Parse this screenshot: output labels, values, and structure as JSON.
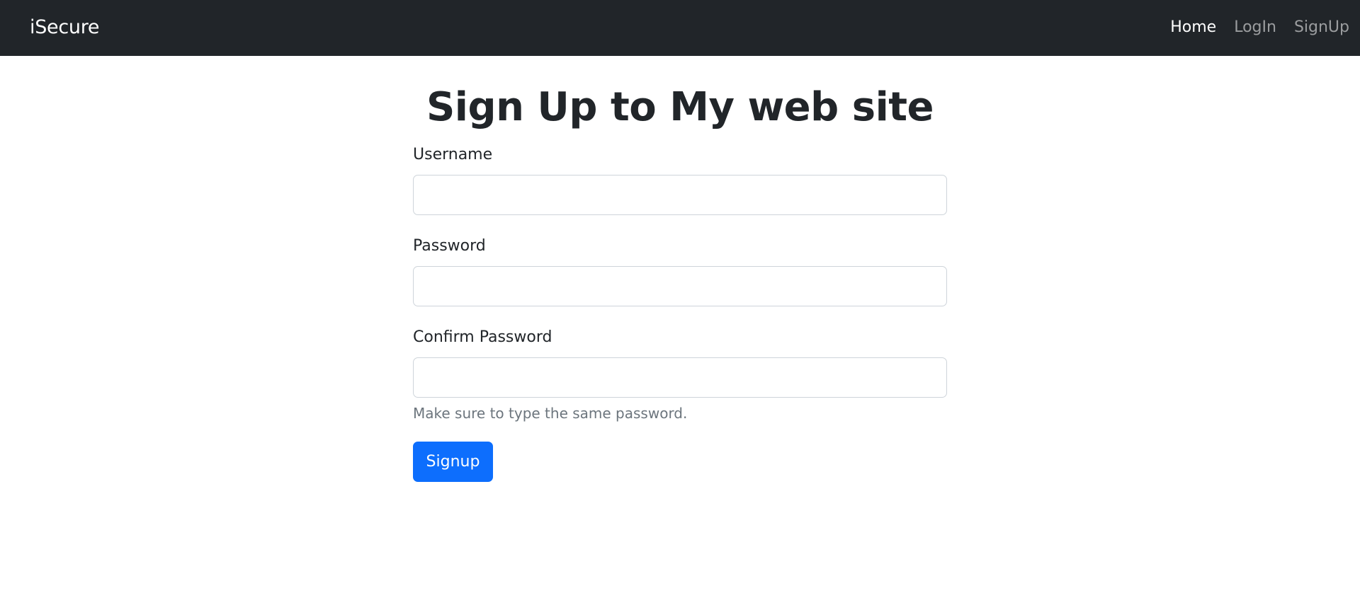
{
  "navbar": {
    "brand": "iSecure",
    "links": [
      {
        "label": "Home",
        "active": true
      },
      {
        "label": "LogIn",
        "active": false
      },
      {
        "label": "SignUp",
        "active": false
      }
    ]
  },
  "page": {
    "title": "Sign Up to My web site"
  },
  "form": {
    "username": {
      "label": "Username",
      "value": "",
      "placeholder": ""
    },
    "password": {
      "label": "Password",
      "value": "",
      "placeholder": ""
    },
    "confirm_password": {
      "label": "Confirm Password",
      "value": "",
      "placeholder": ""
    },
    "help_text": "Make sure to type the same password.",
    "submit_label": "Signup"
  },
  "colors": {
    "navbar_bg": "#212529",
    "primary": "#0d6efd",
    "muted_text": "#6c757d"
  }
}
